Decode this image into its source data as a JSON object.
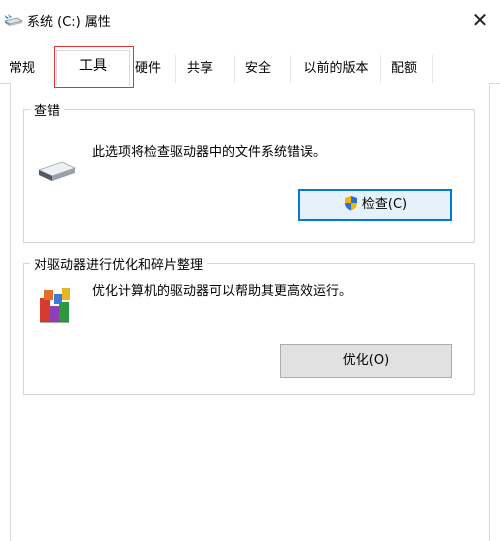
{
  "window": {
    "title": "系统 (C:) 属性",
    "close_glyph": "✕"
  },
  "tabs": [
    {
      "label": "常规",
      "active": false
    },
    {
      "label": "工具",
      "active": true
    },
    {
      "label": "硬件",
      "active": false
    },
    {
      "label": "共享",
      "active": false
    },
    {
      "label": "安全",
      "active": false
    },
    {
      "label": "以前的版本",
      "active": false
    },
    {
      "label": "配额",
      "active": false
    }
  ],
  "error_check": {
    "title": "查错",
    "message": "此选项将检查驱动器中的文件系统错误。",
    "button_label": "检查(C)",
    "icon": "drive-icon",
    "button_icon": "uac-shield-icon"
  },
  "optimize": {
    "title": "对驱动器进行优化和碎片整理",
    "message": "优化计算机的驱动器可以帮助其更高效运行。",
    "button_label": "优化(O)",
    "icon": "defrag-icon"
  },
  "colors": {
    "focus": "#0078d7",
    "highlight": "#e0343d"
  }
}
